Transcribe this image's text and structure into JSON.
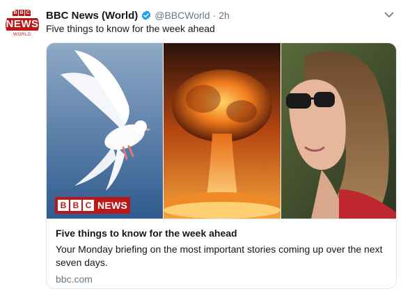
{
  "tweet": {
    "avatar": {
      "blocks": [
        "B",
        "B",
        "C"
      ],
      "news": "NEWS",
      "world": "WORLD"
    },
    "display_name": "BBC News (World)",
    "handle": "@BBCWorld",
    "separator": "·",
    "time": "2h",
    "text": "Five things to know for the week ahead",
    "verified_icon": "verified-badge-icon",
    "menu_icon": "chevron-down-icon"
  },
  "card": {
    "logo_blocks": [
      "B",
      "B",
      "C"
    ],
    "logo_news": "NEWS",
    "title": "Five things to know for the week ahead",
    "description": "Your Monday briefing on the most important stories coming up over the next seven days.",
    "domain": "bbc.com"
  },
  "colors": {
    "bbc_red": "#bb1919",
    "verified_blue": "#1da1f2",
    "muted_text": "#657786"
  }
}
